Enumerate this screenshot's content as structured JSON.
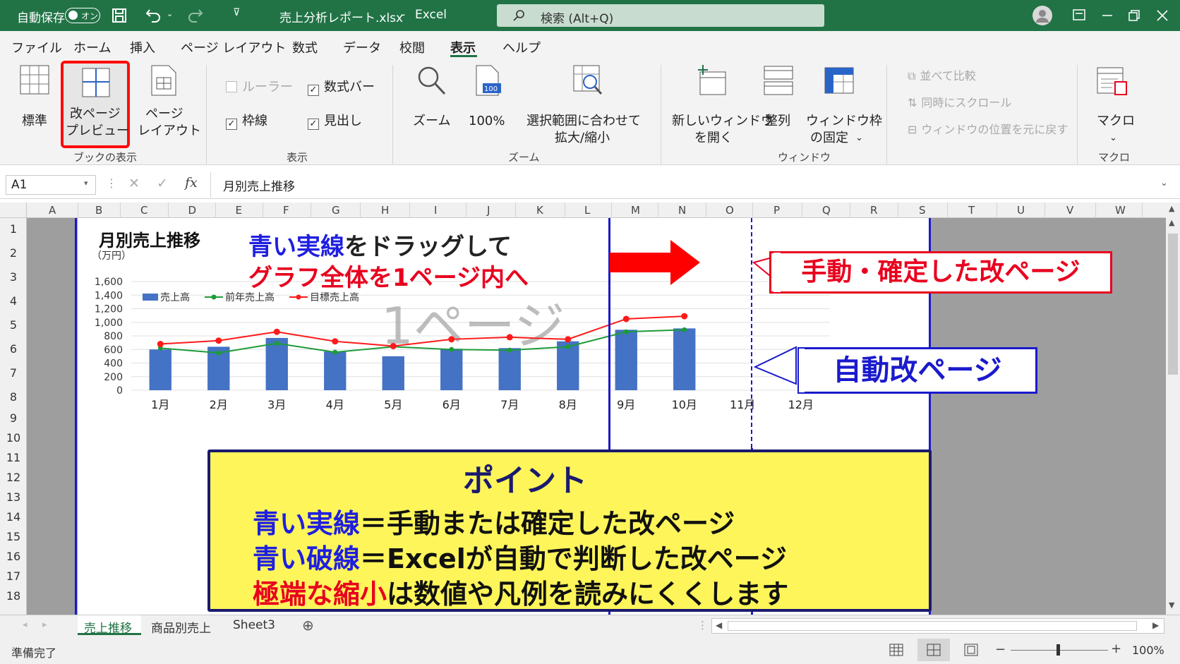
{
  "titlebar": {
    "autosave_label": "自動保存",
    "autosave_state": "オン",
    "filename": "売上分析レポート.xlsx",
    "separator": "-",
    "app": "Excel",
    "search_placeholder": "検索 (Alt+Q)"
  },
  "menu": [
    "ファイル",
    "ホーム",
    "挿入",
    "ページ レイアウト",
    "数式",
    "データ",
    "校閲",
    "表示",
    "ヘルプ"
  ],
  "menu_active": "表示",
  "ribbon": {
    "workbook_views": {
      "normal": "標準",
      "page_break_1": "改ページ",
      "page_break_2": "プレビュー",
      "page_layout_1": "ページ",
      "page_layout_2": "レイアウト",
      "group": "ブックの表示"
    },
    "show": {
      "ruler": "ルーラー",
      "formula_bar": "数式バー",
      "gridlines": "枠線",
      "headings": "見出し",
      "group": "表示"
    },
    "zoom": {
      "zoom": "ズーム",
      "pct": "100%",
      "fit_1": "選択範囲に合わせて",
      "fit_2": "拡大/縮小",
      "group": "ズーム"
    },
    "window": {
      "new_1": "新しいウィンドウ",
      "new_2": "を開く",
      "arrange": "整列",
      "freeze_1": "ウィンドウ枠",
      "freeze_2": "の固定",
      "compare": "並べて比較",
      "sync": "同時にスクロール",
      "reset": "ウィンドウの位置を元に戻す",
      "group": "ウィンドウ"
    },
    "macro": {
      "label": "マクロ",
      "group": "マクロ"
    }
  },
  "formula": {
    "namebox": "A1",
    "fx": "fx",
    "content": "月別売上推移"
  },
  "columns": [
    "A",
    "B",
    "C",
    "D",
    "E",
    "F",
    "G",
    "H",
    "I",
    "J",
    "K",
    "L",
    "M",
    "N",
    "O",
    "P",
    "Q",
    "R",
    "S",
    "T",
    "U",
    "V",
    "W"
  ],
  "rows": [
    "1",
    "2",
    "3",
    "4",
    "5",
    "6",
    "7",
    "8",
    "9",
    "10",
    "11",
    "12",
    "13",
    "14",
    "15",
    "16",
    "17",
    "18"
  ],
  "sheet": {
    "title": "月別売上推移",
    "page_watermark": "1ページ"
  },
  "annotations": {
    "drag_1a": "青い実線",
    "drag_1b": "をドラッグして",
    "drag_2": "グラフ全体を1ページ内へ",
    "manual": "手動・確定した改ページ",
    "auto": "自動改ページ"
  },
  "point": {
    "title": "ポイント",
    "l1a": "青い実線",
    "l1b": "＝手動または確定した改ページ",
    "l2a": "青い破線",
    "l2b": "＝Excelが自動で判断した改ページ",
    "l3a": "極端な縮小",
    "l3b": "は数値や凡例を読みにくくします"
  },
  "chart_data": {
    "type": "bar",
    "ylabel": "（万円）",
    "ylim": [
      0,
      1600
    ],
    "yticks": [
      "1,600",
      "1,400",
      "1,200",
      "1,000",
      "800",
      "600",
      "400",
      "200",
      "0"
    ],
    "categories": [
      "1月",
      "2月",
      "3月",
      "4月",
      "5月",
      "6月",
      "7月",
      "8月",
      "9月",
      "10月",
      "11月",
      "12月"
    ],
    "series": [
      {
        "name": "売上高",
        "kind": "bar",
        "color": "#4472c4",
        "values": [
          600,
          640,
          770,
          570,
          500,
          610,
          620,
          720,
          890,
          910,
          null,
          null
        ]
      },
      {
        "name": "前年売上高",
        "kind": "line",
        "color": "#1e9b3a",
        "values": [
          620,
          550,
          690,
          560,
          640,
          600,
          590,
          640,
          860,
          890,
          null,
          null
        ]
      },
      {
        "name": "目標売上高",
        "kind": "line",
        "color": "#ff1a1a",
        "values": [
          680,
          730,
          860,
          720,
          650,
          750,
          780,
          750,
          1050,
          1090,
          null,
          null
        ]
      }
    ],
    "legend": "top-left",
    "grid": true
  },
  "tabs": [
    "売上推移",
    "商品別売上",
    "Sheet3"
  ],
  "active_tab": "売上推移",
  "status": {
    "ready": "準備完了",
    "zoom": "100%"
  }
}
